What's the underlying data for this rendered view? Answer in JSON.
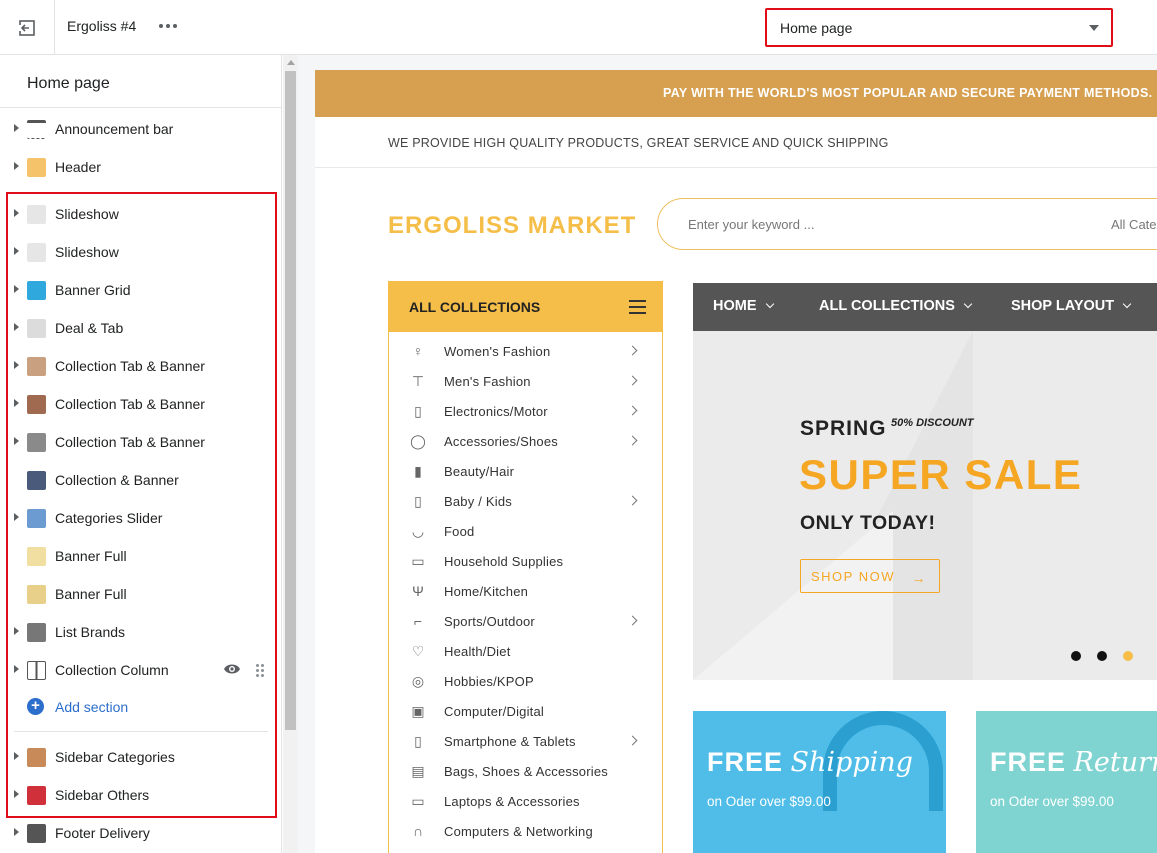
{
  "topbar": {
    "theme_name": "Ergoliss #4",
    "page_select_value": "Home page"
  },
  "sidebar": {
    "title": "Home page",
    "items": [
      {
        "label": "Announcement bar",
        "icon": "announcement-bar-icon",
        "color": "#555555"
      },
      {
        "label": "Header",
        "icon": "header-icon",
        "color": "#f5c36a"
      },
      {
        "label": "Slideshow",
        "icon": "slideshow-thumb",
        "color": "#e6e6e6"
      },
      {
        "label": "Slideshow",
        "icon": "slideshow-thumb",
        "color": "#e6e6e6"
      },
      {
        "label": "Banner Grid",
        "icon": "banner-grid-thumb",
        "color": "#2fa8dd"
      },
      {
        "label": "Deal & Tab",
        "icon": "deal-tab-thumb",
        "color": "#dcdcdc"
      },
      {
        "label": "Collection Tab & Banner",
        "icon": "collection-tab-banner-thumb",
        "color": "#c9a080"
      },
      {
        "label": "Collection Tab & Banner",
        "icon": "collection-tab-banner-thumb",
        "color": "#a06a50"
      },
      {
        "label": "Collection Tab & Banner",
        "icon": "collection-tab-banner-thumb",
        "color": "#8a8a8a"
      },
      {
        "label": "Collection & Banner",
        "icon": "collection-banner-thumb",
        "color": "#4a5a7a"
      },
      {
        "label": "Categories Slider",
        "icon": "categories-slider-thumb",
        "color": "#6b9bd1"
      },
      {
        "label": "Banner Full",
        "icon": "banner-full-thumb",
        "color": "#f0dfa0"
      },
      {
        "label": "Banner Full",
        "icon": "banner-full-thumb",
        "color": "#e8cf8a"
      },
      {
        "label": "List Brands",
        "icon": "list-brands-thumb",
        "color": "#777777"
      },
      {
        "label": "Collection Column",
        "icon": "column-layout-icon",
        "color": "#555555"
      }
    ],
    "add_section_label": "Add section",
    "bottom_items": [
      {
        "label": "Sidebar Categories",
        "icon": "sidebar-categories-icon",
        "color": "#c98a5a"
      },
      {
        "label": "Sidebar Others",
        "icon": "sidebar-others-icon",
        "color": "#d0303a"
      },
      {
        "label": "Footer Delivery",
        "icon": "footer-delivery-icon",
        "color": "#555555"
      }
    ]
  },
  "store": {
    "promo_text": "PAY WITH THE WORLD'S MOST POPULAR AND SECURE PAYMENT METHODS.",
    "provide_text": "WE PROVIDE HIGH QUALITY PRODUCTS, GREAT SERVICE AND QUICK SHIPPING",
    "logo": "ERGOLISS MARKET",
    "search_placeholder": "Enter your keyword ...",
    "search_category": "All Categories",
    "collections_title": "ALL COLLECTIONS",
    "collections": [
      {
        "label": "Women's Fashion",
        "icon": "dress-icon",
        "arrow": true
      },
      {
        "label": "Men's Fashion",
        "icon": "shirt-icon",
        "arrow": true
      },
      {
        "label": "Electronics/Motor",
        "icon": "blender-icon",
        "arrow": true
      },
      {
        "label": "Accessories/Shoes",
        "icon": "ring-icon",
        "arrow": true
      },
      {
        "label": "Beauty/Hair",
        "icon": "lipstick-icon",
        "arrow": false
      },
      {
        "label": "Baby / Kids",
        "icon": "bottle-icon",
        "arrow": true
      },
      {
        "label": "Food",
        "icon": "bowl-icon",
        "arrow": false
      },
      {
        "label": "Household Supplies",
        "icon": "household-icon",
        "arrow": false
      },
      {
        "label": "Home/Kitchen",
        "icon": "utensils-icon",
        "arrow": false
      },
      {
        "label": "Sports/Outdoor",
        "icon": "sneaker-icon",
        "arrow": true
      },
      {
        "label": "Health/Diet",
        "icon": "heart-pulse-icon",
        "arrow": false
      },
      {
        "label": "Hobbies/KPOP",
        "icon": "vinyl-icon",
        "arrow": false
      },
      {
        "label": "Computer/Digital",
        "icon": "camera-icon",
        "arrow": false
      },
      {
        "label": "Smartphone & Tablets",
        "icon": "smartphone-icon",
        "arrow": true
      },
      {
        "label": "Bags, Shoes & Accessories",
        "icon": "bag-icon",
        "arrow": false
      },
      {
        "label": "Laptops & Accessories",
        "icon": "laptop-icon",
        "arrow": false
      },
      {
        "label": "Computers & Networking",
        "icon": "headphones-icon",
        "arrow": false
      }
    ],
    "nav": [
      {
        "label": "HOME"
      },
      {
        "label": "ALL COLLECTIONS"
      },
      {
        "label": "SHOP LAYOUT"
      }
    ],
    "slide": {
      "spring": "SPRING",
      "discount": "50% DISCOUNT",
      "headline": "SUPER SALE",
      "subline": "ONLY TODAY!",
      "button": "SHOP NOW",
      "active_dot": 3,
      "dot_count": 3
    },
    "banners": [
      {
        "bold": "FREE",
        "italic": "Shipping",
        "sub": "on Oder over $99.00"
      },
      {
        "bold": "FREE",
        "italic": "Return",
        "sub": "on Oder over $99.00"
      }
    ]
  }
}
